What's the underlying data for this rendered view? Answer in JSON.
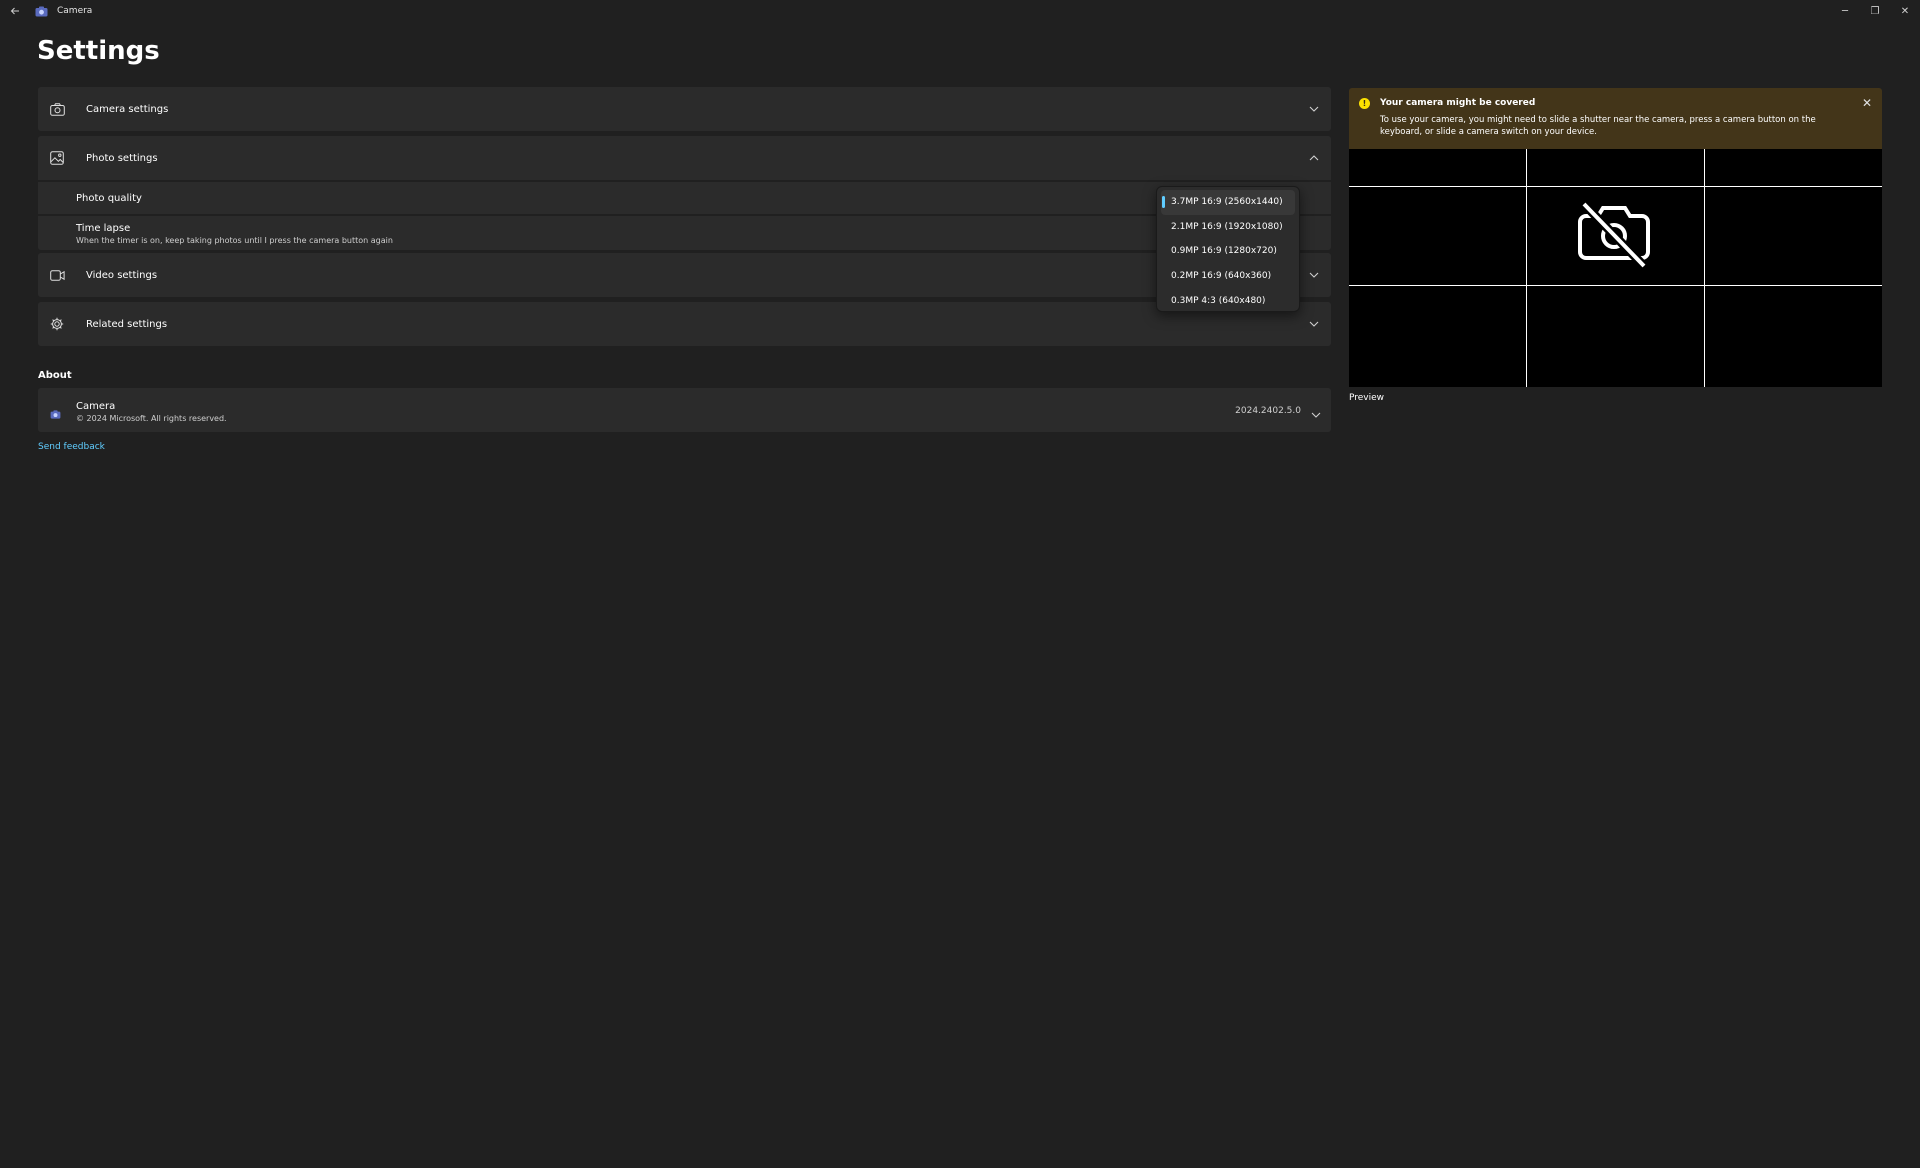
{
  "window": {
    "title": "Camera",
    "back_icon": "back-arrow-icon",
    "minimize": "─",
    "maximize": "❐",
    "close": "✕"
  },
  "page": {
    "title": "Settings"
  },
  "sections": {
    "camera": {
      "label": "Camera settings",
      "icon": "camera-icon"
    },
    "photo": {
      "label": "Photo settings",
      "icon": "image-icon",
      "photo_quality_label": "Photo quality",
      "time_lapse_label": "Time lapse",
      "time_lapse_desc": "When the timer is on, keep taking photos until I press the camera button again"
    },
    "video": {
      "label": "Video settings",
      "icon": "video-icon"
    },
    "related": {
      "label": "Related settings",
      "icon": "gear-icon"
    }
  },
  "dropdown": {
    "options": [
      "3.7MP 16:9 (2560x1440)",
      "2.1MP 16:9 (1920x1080)",
      "0.9MP 16:9 (1280x720)",
      "0.2MP 16:9 (640x360)",
      "0.3MP 4:3 (640x480)"
    ],
    "selected_index": 0
  },
  "about": {
    "heading": "About",
    "app_name": "Camera",
    "copyright": "© 2024 Microsoft. All rights reserved.",
    "version": "2024.2402.5.0",
    "feedback": "Send feedback"
  },
  "banner": {
    "title": "Your camera might be covered",
    "message": "To use your camera, you might need to slide a shutter near the camera, press a camera button on the keyboard, or slide a camera switch on your device.",
    "warning_glyph": "!",
    "close": "✕"
  },
  "preview": {
    "label": "Preview"
  },
  "colors": {
    "background": "#202020",
    "card": "#2b2b2b",
    "accent": "#60cdff",
    "warning_bg": "#433519",
    "warning_icon": "#fce100"
  }
}
